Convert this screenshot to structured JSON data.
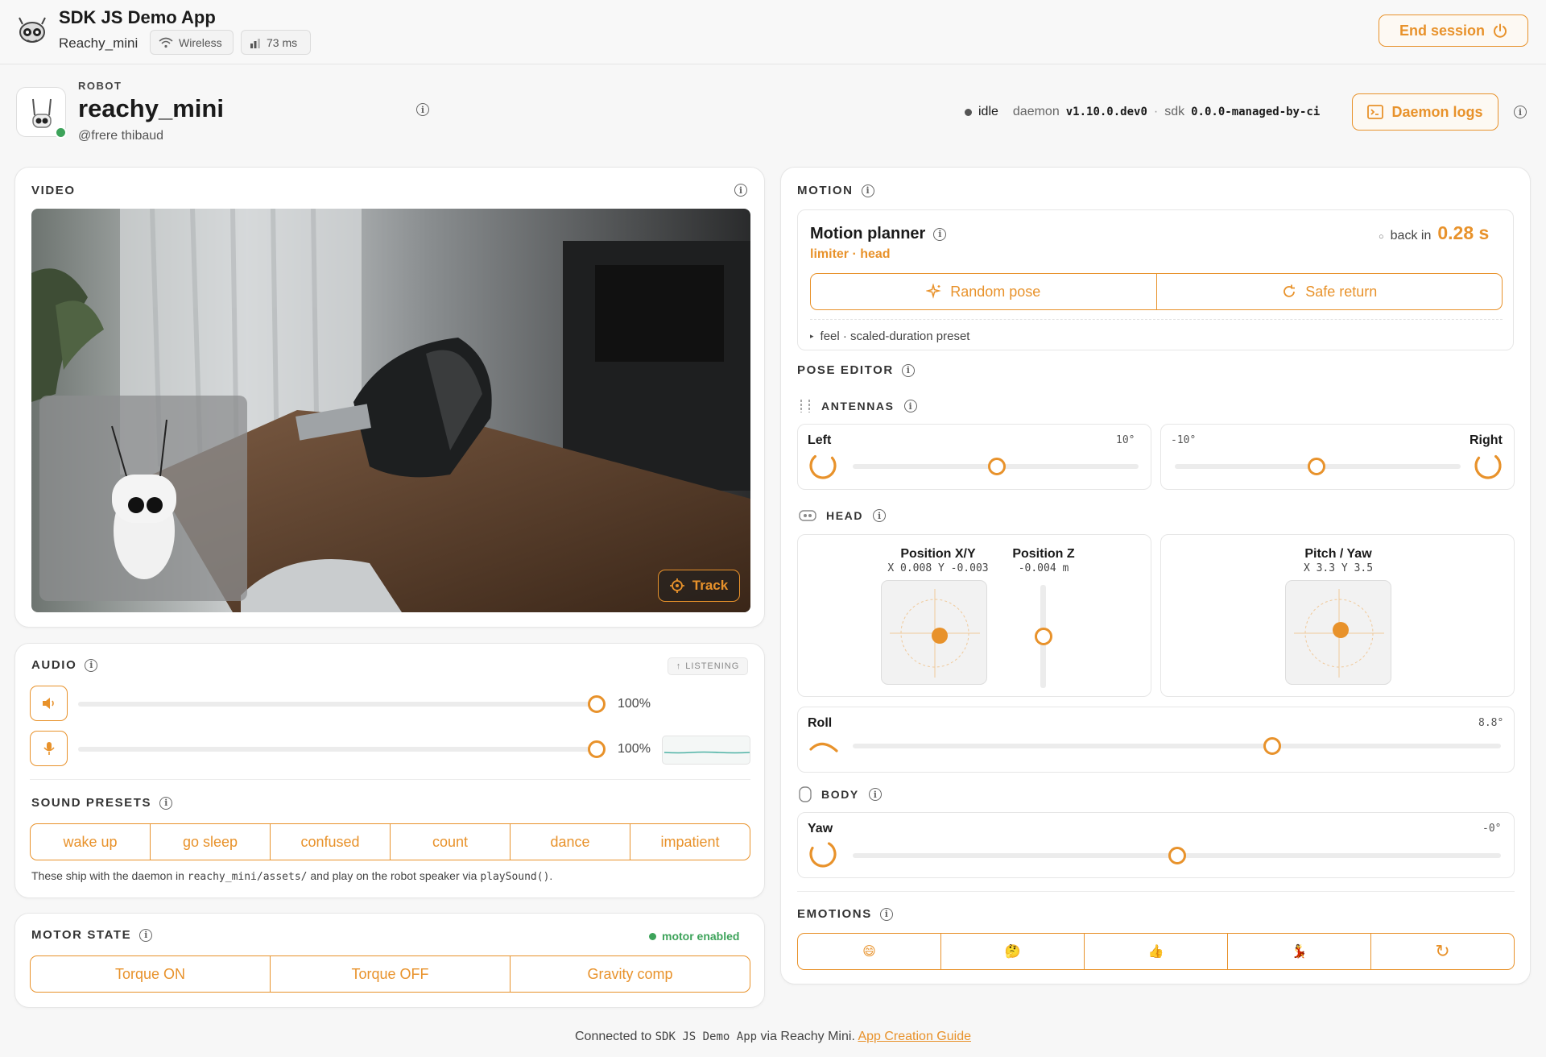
{
  "header": {
    "app_title": "SDK JS Demo App",
    "device_name": "Reachy_mini",
    "connection_label": "Wireless",
    "latency_label": "73 ms",
    "end_session_label": "End session"
  },
  "robot": {
    "section_label": "ROBOT",
    "name": "reachy_mini",
    "owner": "@frere thibaud",
    "status": "idle",
    "daemon_label": "daemon",
    "daemon_version": "v1.10.0.dev0",
    "sdk_label": "sdk",
    "sdk_version": "0.0.0-managed-by-ci",
    "daemon_logs_label": "Daemon logs"
  },
  "video": {
    "section_label": "VIDEO",
    "track_label": "Track"
  },
  "audio": {
    "section_label": "AUDIO",
    "listening_label": "LISTENING",
    "speaker_volume": 100,
    "speaker_value_label": "100%",
    "mic_volume": 100,
    "mic_value_label": "100%"
  },
  "sound_presets": {
    "section_label": "SOUND PRESETS",
    "items": [
      "wake up",
      "go sleep",
      "confused",
      "count",
      "dance",
      "impatient"
    ],
    "note_prefix": "These ship with the daemon in ",
    "note_path": "reachy_mini/assets/",
    "note_middle": " and play on the robot speaker via ",
    "note_fn": "playSound()",
    "note_suffix": "."
  },
  "motor_state": {
    "section_label": "MOTOR STATE",
    "status": "motor enabled",
    "buttons": [
      "Torque ON",
      "Torque OFF",
      "Gravity comp"
    ]
  },
  "motion": {
    "section_label": "MOTION",
    "planner_title": "Motion planner",
    "planner_sub": "limiter · head",
    "back_in_label": "back in",
    "back_in_value": "0.28 s",
    "random_pose_label": "Random pose",
    "safe_return_label": "Safe return",
    "feel_label": "feel · scaled-duration preset"
  },
  "pose_editor": {
    "section_label": "POSE EDITOR",
    "antennas": {
      "label": "ANTENNAS",
      "left_label": "Left",
      "left_value": "10°",
      "left_position": 0.52,
      "right_label": "Right",
      "right_value": "-10°",
      "right_position": 0.48
    },
    "head": {
      "label": "HEAD",
      "pos_xy_title": "Position X/Y",
      "pos_xy_readout": "X 0.008 Y -0.003",
      "pos_z_title": "Position Z",
      "pos_z_readout": "-0.004 m",
      "pitch_yaw_title": "Pitch / Yaw",
      "pitch_yaw_readout": "X 3.3 Y 3.5",
      "roll_label": "Roll",
      "roll_value": "8.8°",
      "roll_position": 0.65
    },
    "body": {
      "label": "BODY",
      "yaw_label": "Yaw",
      "yaw_value": "-0°",
      "yaw_position": 0.5
    }
  },
  "emotions": {
    "section_label": "EMOTIONS",
    "items": [
      "😄",
      "🤔",
      "👍",
      "💃",
      "↻"
    ]
  },
  "footer": {
    "prefix": "Connected to ",
    "app": "SDK JS Demo App",
    "middle": " via ",
    "device": "Reachy Mini",
    "suffix": ". ",
    "link": "App Creation Guide"
  },
  "colors": {
    "accent": "#e8922b",
    "success": "#3da35a"
  }
}
